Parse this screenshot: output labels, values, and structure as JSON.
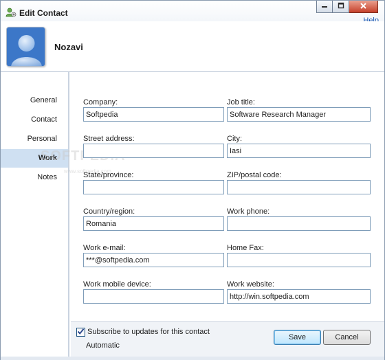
{
  "window": {
    "title": "Edit Contact",
    "help_label": "Help"
  },
  "header": {
    "contact_name": "Nozavi"
  },
  "sidebar": {
    "items": [
      {
        "label": "General"
      },
      {
        "label": "Contact"
      },
      {
        "label": "Personal"
      },
      {
        "label": "Work",
        "active": true
      },
      {
        "label": "Notes"
      }
    ]
  },
  "form": {
    "company": {
      "label": "Company:",
      "value": "Softpedia"
    },
    "job_title": {
      "label": "Job title:",
      "value": "Software Research Manager"
    },
    "street": {
      "label": "Street address:",
      "value": ""
    },
    "city": {
      "label": "City:",
      "value": "Iasi"
    },
    "state": {
      "label": "State/province:",
      "value": ""
    },
    "zip": {
      "label": "ZIP/postal code:",
      "value": ""
    },
    "country": {
      "label": "Country/region:",
      "value": "Romania"
    },
    "work_phone": {
      "label": "Work phone:",
      "value": ""
    },
    "work_email": {
      "label": "Work e-mail:",
      "value": "***@softpedia.com"
    },
    "home_fax": {
      "label": "Home Fax:",
      "value": ""
    },
    "work_mobile": {
      "label": "Work mobile device:",
      "value": ""
    },
    "work_website": {
      "label": "Work website:",
      "value": "http://win.softpedia.com"
    }
  },
  "footer": {
    "subscribe_label": "Subscribe to updates for this contact",
    "subscribe_checked": true,
    "automatic_label": "Automatic",
    "save_label": "Save",
    "cancel_label": "Cancel"
  },
  "watermark": {
    "text": "SOFTPEDIA",
    "sub": "www.softpedia.com"
  },
  "icons": {
    "app": "contact-icon",
    "minimize": "minimize-icon",
    "maximize": "maximize-icon",
    "close": "close-icon",
    "avatar": "person-avatar"
  },
  "colors": {
    "accent": "#1a58b3",
    "active_nav": "#cfe0f2",
    "close_button": "#c6402a"
  }
}
